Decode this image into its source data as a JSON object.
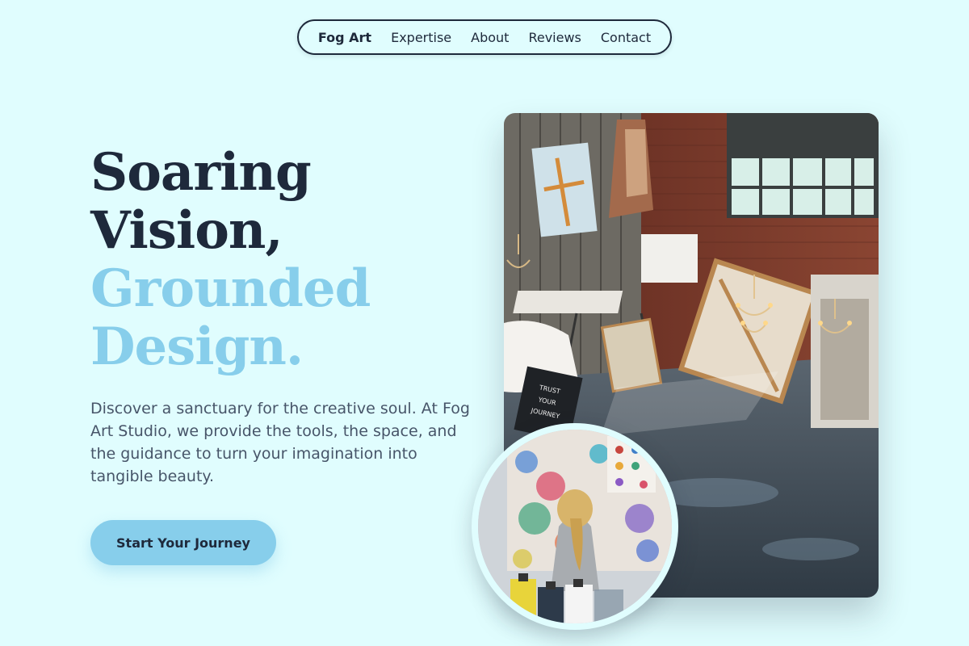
{
  "nav": {
    "brand": "Fog Art",
    "links": [
      "Expertise",
      "About",
      "Reviews",
      "Contact"
    ]
  },
  "hero": {
    "line1": "Soaring",
    "line2": "Vision,",
    "line3": "Grounded",
    "line4": "Design.",
    "description": "Discover a sanctuary for the creative soul. At Fog Art Studio, we provide the tools, the space, and the guidance to turn your imagination into tangible beauty.",
    "cta_label": "Start Your Journey"
  },
  "images": {
    "studio_alt": "Art studio interior with canvases, brick wall and windows",
    "child_alt": "Child painting on a colorful paint-splattered wall"
  },
  "colors": {
    "background": "#e0fdfe",
    "text_dark": "#1e293b",
    "accent": "#87ceeb",
    "body_text": "#475569"
  }
}
